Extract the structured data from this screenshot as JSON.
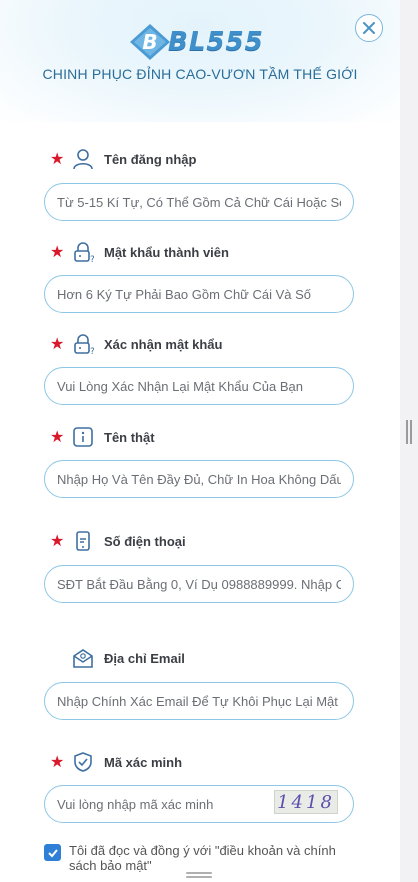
{
  "brand": {
    "name": "BL555",
    "slogan": "CHINH PHỤC ĐỈNH CAO-VƯƠN TẦM THẾ GIỚI"
  },
  "fields": [
    {
      "key": "username",
      "required": true,
      "icon": "user-icon",
      "label": "Tên đăng nhập",
      "placeholder": "Từ 5-15 Kí Tự, Có Thể Gồm Cả Chữ Cái Hoặc Số"
    },
    {
      "key": "password",
      "required": true,
      "icon": "lock-question-icon",
      "label": "Mật khẩu thành viên",
      "placeholder": "Hơn 6 Ký Tự Phải Bao Gồm Chữ Cái Và Số"
    },
    {
      "key": "confirm_password",
      "required": true,
      "icon": "lock-question-icon",
      "label": "Xác nhận mật khẩu",
      "placeholder": "Vui Lòng Xác Nhận Lại Mật Khẩu Của Bạn"
    },
    {
      "key": "real_name",
      "required": true,
      "icon": "info-icon",
      "label": "Tên thật",
      "placeholder": "Nhập Họ Và Tên Đầy Đủ, Chữ In Hoa Không Dấu,"
    },
    {
      "key": "phone",
      "required": true,
      "icon": "phone-icon",
      "label": "Số điện thoại",
      "placeholder": "SĐT Bắt Đầu Bằng 0, Ví Dụ 0988889999. Nhập Ch"
    },
    {
      "key": "email",
      "required": false,
      "icon": "email-icon",
      "label": "Địa chỉ Email",
      "placeholder": "Nhập Chính Xác Email Để Tự Khôi Phục Lại Mật K"
    },
    {
      "key": "verify_code",
      "required": true,
      "icon": "shield-check-icon",
      "label": "Mã xác minh",
      "placeholder": "Vui lòng nhập mã xác minh"
    }
  ],
  "captcha": {
    "code": "1418"
  },
  "agreement": {
    "checked": true,
    "text": "Tôi đã đọc và đồng ý với \"điều khoản và chính sách bảo mật\""
  },
  "colors": {
    "accent": "#3f8fca",
    "required_star": "#d9182b",
    "input_border": "#8ec7e6",
    "checkbox": "#2f7fd6"
  }
}
